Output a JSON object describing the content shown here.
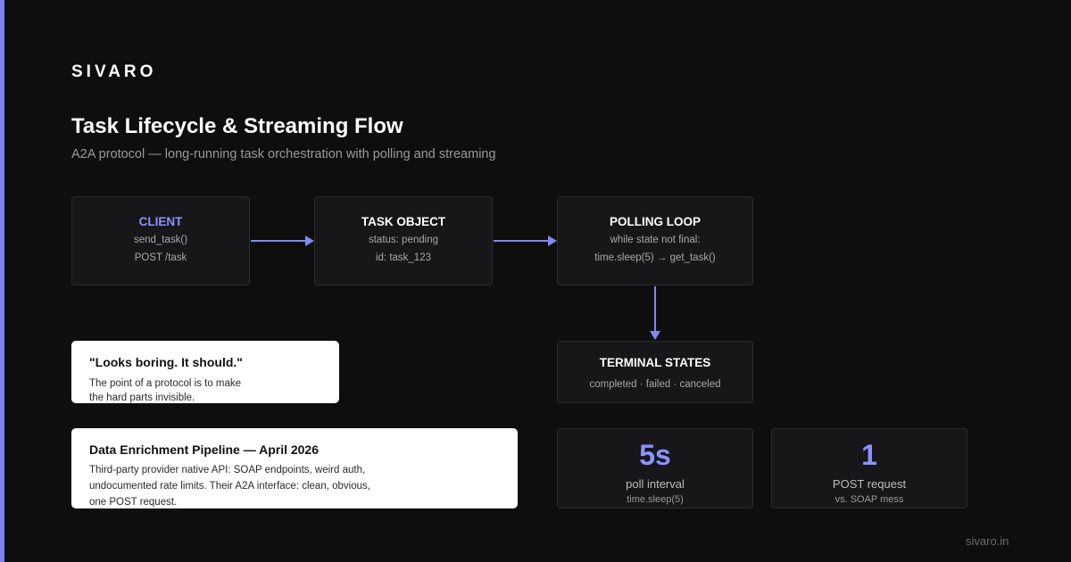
{
  "brand": "SIVARO",
  "title": "Task Lifecycle & Streaming Flow",
  "subtitle": "A2A protocol — long-running task orchestration with polling and streaming",
  "colors": {
    "accent": "#7b82f0",
    "background": "#0e0e0e",
    "box": "#17171a"
  },
  "flow": {
    "client": {
      "title": "CLIENT",
      "lines": [
        "send_task()",
        "POST /task"
      ]
    },
    "task_object": {
      "title": "TASK OBJECT",
      "lines": [
        "status: pending",
        "id: task_123"
      ]
    },
    "polling_loop": {
      "title": "POLLING LOOP",
      "lines": [
        "while state not final:",
        "time.sleep(5) → get_task()"
      ]
    },
    "terminal_states": {
      "title": "TERMINAL STATES",
      "lines": [
        "completed · failed · canceled"
      ]
    }
  },
  "quote_card": {
    "title": "\"Looks boring. It should.\"",
    "lines": [
      "The point of a protocol is to make",
      "the hard parts invisible."
    ]
  },
  "pipeline_card": {
    "title": "Data Enrichment Pipeline — April 2026",
    "lines": [
      "Third-party provider native API: SOAP endpoints, weird auth,",
      "undocumented rate limits. Their A2A interface: clean, obvious,",
      "one POST request."
    ]
  },
  "stats": [
    {
      "value": "5s",
      "label": "poll interval",
      "sub": "time.sleep(5)"
    },
    {
      "value": "1",
      "label": "POST request",
      "sub": "vs. SOAP mess"
    }
  ],
  "footer_url": "sivaro.in"
}
